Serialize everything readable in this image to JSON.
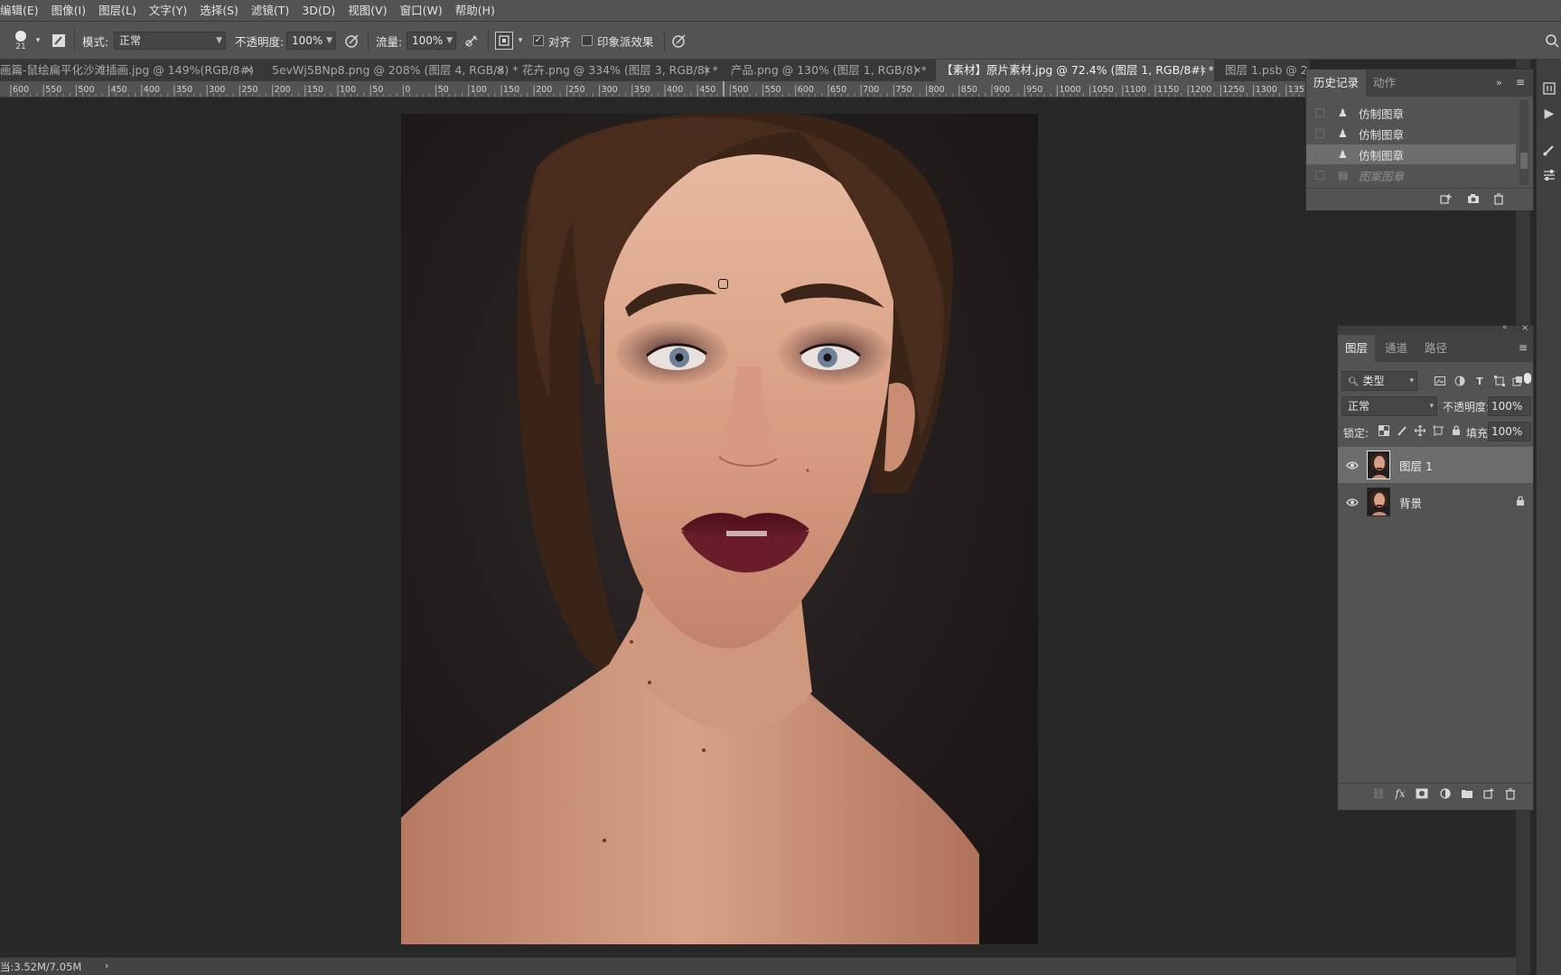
{
  "menu": [
    "编辑(E)",
    "图像(I)",
    "图层(L)",
    "文字(Y)",
    "选择(S)",
    "滤镜(T)",
    "3D(D)",
    "视图(V)",
    "窗口(W)",
    "帮助(H)"
  ],
  "options": {
    "brush_size": "21",
    "mode_label": "模式:",
    "mode_value": "正常",
    "opacity_label": "不透明度:",
    "opacity_value": "100%",
    "flow_label": "流量:",
    "flow_value": "100%",
    "aligned_label": "对齐",
    "aligned_checked": "✓",
    "impressionist_label": "印象派效果"
  },
  "tabs": [
    {
      "label": "画篇-鼠绘扁平化沙滩插画.jpg @ 149%(RGB/8#)",
      "close": "×"
    },
    {
      "label": "5evWj5BNp8.png @ 208% (图层 4, RGB/8) *",
      "close": "×"
    },
    {
      "label": "花卉.png @ 334% (图层 3, RGB/8) *",
      "close": "×"
    },
    {
      "label": "产品.png @ 130% (图层 1, RGB/8) *",
      "close": "×"
    },
    {
      "label": "【素材】原片素材.jpg @ 72.4% (图层 1, RGB/8#) *",
      "close": "×"
    },
    {
      "label": "图层 1.psb @ 2"
    }
  ],
  "ruler_labels": [
    "600",
    "550",
    "500",
    "450",
    "400",
    "350",
    "300",
    "250",
    "200",
    "150",
    "100",
    "50",
    "0",
    "50",
    "100",
    "150",
    "200",
    "250",
    "300",
    "350",
    "400",
    "450",
    "500",
    "550",
    "600",
    "650",
    "700",
    "750",
    "800",
    "850",
    "900",
    "950",
    "1000",
    "1050",
    "1100",
    "1150",
    "1200",
    "1250",
    "1300",
    "135"
  ],
  "history": {
    "tabs": [
      "历史记录",
      "动作"
    ],
    "items": [
      {
        "label": "仿制图章",
        "icon": "stamp-icon"
      },
      {
        "label": "仿制图章",
        "icon": "stamp-icon"
      },
      {
        "label": "仿制图章",
        "icon": "stamp-icon",
        "selected": true
      },
      {
        "label": "图案图章",
        "icon": "pattern-stamp-icon"
      }
    ]
  },
  "layers": {
    "tabs": [
      "图层",
      "通道",
      "路径"
    ],
    "filter_label": "类型",
    "blend_mode": "正常",
    "opacity_label": "不透明度:",
    "opacity_value": "100%",
    "lock_label": "锁定:",
    "fill_label": "填充:",
    "fill_value": "100%",
    "items": [
      {
        "name": "图层 1",
        "selected": true,
        "locked": false
      },
      {
        "name": "背景",
        "selected": false,
        "locked": true
      }
    ]
  },
  "status": {
    "text": "当:3.52M/7.05M"
  },
  "colors": {
    "ui_dark": "#282828",
    "ui_panel": "#535353",
    "ui_selected": "#6d6d6d",
    "lip_color": "#5a1420",
    "skin_color": "#d9a58a",
    "hair_color": "#3b2418"
  }
}
